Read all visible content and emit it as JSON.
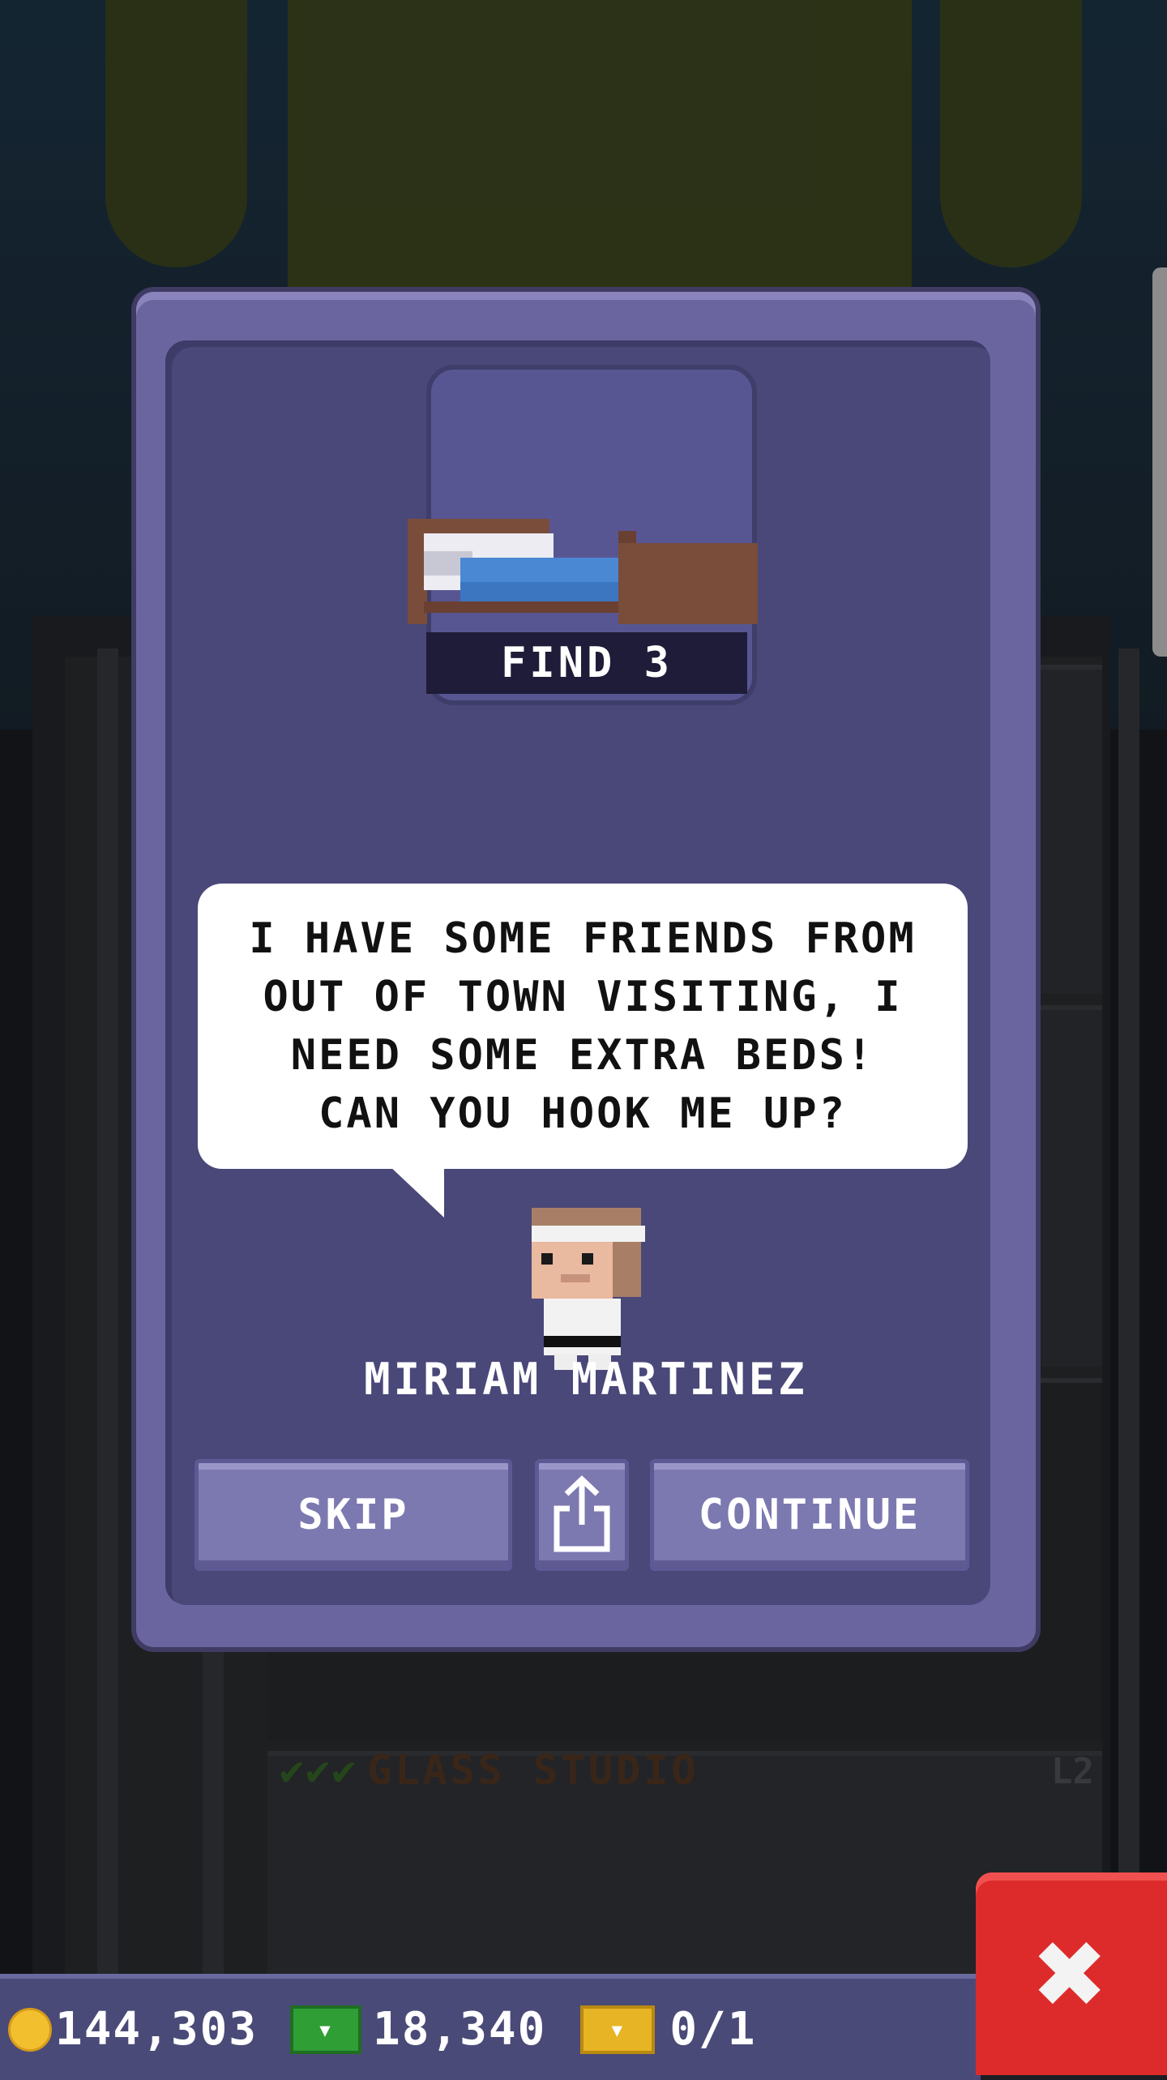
{
  "modal": {
    "requirement": "FIND 3",
    "speech": "I HAVE SOME FRIENDS FROM\nOUT OF TOWN VISITING, I\nNEED SOME EXTRA BEDS!\nCAN YOU HOOK ME UP?",
    "npc_name": "MIRIAM MARTINEZ",
    "buttons": {
      "skip": "SKIP",
      "share_icon": "share-icon",
      "continue": "CONTINUE"
    },
    "item_icon": "bed-icon"
  },
  "background": {
    "floor_name": "GLASS STUDIO",
    "floor_level": "L2",
    "floor_checks": "✔✔✔"
  },
  "status_bar": {
    "coins": "144,303",
    "bux": "18,340",
    "tickets": "0/1"
  },
  "colors": {
    "modal_frame": "#6b659f",
    "modal_inner": "#4a4879",
    "button": "#7c78b0",
    "close_button": "#dd2b2b"
  }
}
